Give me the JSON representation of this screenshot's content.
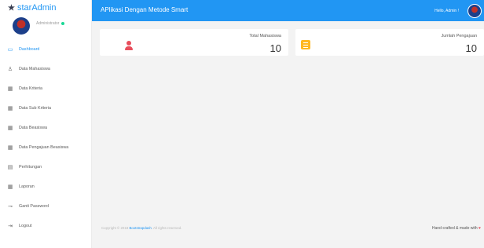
{
  "brand": {
    "star": "★",
    "star_text": "star",
    "admin_text": "Admin"
  },
  "profile": {
    "role": "Administrator"
  },
  "sidebar": {
    "items": [
      {
        "label": "Dashboard",
        "icon": "monitor-icon",
        "glyph": "▭"
      },
      {
        "label": "Data Mahasiswa",
        "icon": "user-icon",
        "glyph": "♙"
      },
      {
        "label": "Data Kriteria",
        "icon": "table-icon",
        "glyph": "▦"
      },
      {
        "label": "Data Sub Kriteria",
        "icon": "table-icon",
        "glyph": "▦"
      },
      {
        "label": "Data Beasiswa",
        "icon": "table-icon",
        "glyph": "▦"
      },
      {
        "label": "Data Pengajuan Beasiswa",
        "icon": "table-icon",
        "glyph": "▦"
      },
      {
        "label": "Perhitungan",
        "icon": "calculator-icon",
        "glyph": "▤"
      },
      {
        "label": "Laporan",
        "icon": "report-icon",
        "glyph": "▦"
      },
      {
        "label": "Ganti Password",
        "icon": "key-icon",
        "glyph": "⊸"
      },
      {
        "label": "Logout",
        "icon": "logout-icon",
        "glyph": "⇥"
      }
    ],
    "active_index": 0
  },
  "topbar": {
    "title": "APlikasi Dengan Metode Smart",
    "greeting": "Hello, Admin !"
  },
  "cards": [
    {
      "label": "Total Mahasiswa",
      "value": "10",
      "icon": "user-icon",
      "icon_color": "#e84e5c"
    },
    {
      "label": "Jumlah Pengajuan",
      "value": "10",
      "icon": "list-icon",
      "icon_color": "#ffb822"
    }
  ],
  "footer": {
    "copyright_prefix": "Copyright © 2018 ",
    "copyright_link": "Bootstrapdash",
    "copyright_suffix": ". All rights reserved.",
    "made_with": "Hand-crafted & made with ",
    "heart": "♥"
  },
  "colors": {
    "accent": "#2196f3",
    "danger": "#e84e5c",
    "warning": "#ffb822",
    "online": "#19d895"
  }
}
